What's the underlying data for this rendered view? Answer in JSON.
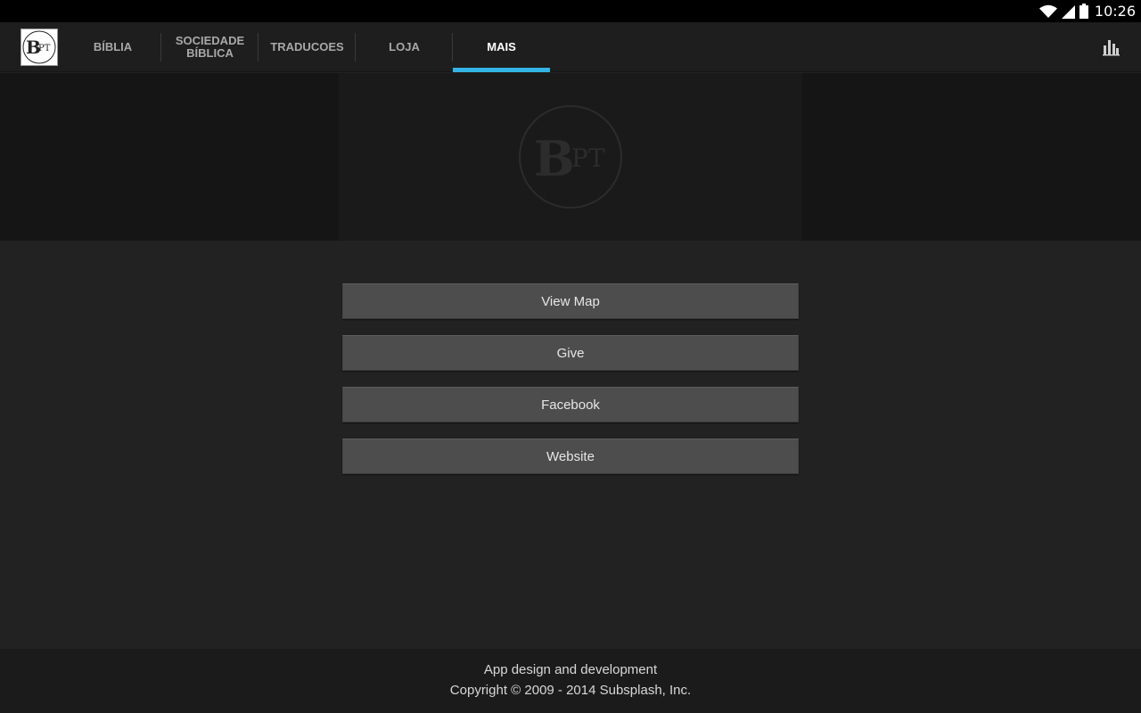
{
  "status_bar": {
    "time": "10:26",
    "icons": [
      "wifi-icon",
      "signal-icon",
      "battery-icon"
    ]
  },
  "app_bar": {
    "logo": {
      "letter_big": "B",
      "letter_small": "PT"
    },
    "tabs": [
      {
        "label": "BÍBLIA",
        "active": false
      },
      {
        "label_line1": "SOCIEDADE",
        "label_line2": "BÍBLICA",
        "active": false
      },
      {
        "label": "TRADUCOES",
        "active": false
      },
      {
        "label": "LOJA",
        "active": false
      },
      {
        "label": "MAIS",
        "active": true
      }
    ],
    "action_icon": "bar-chart-icon"
  },
  "header": {
    "logo": {
      "letter_big": "B",
      "letter_small": "PT"
    }
  },
  "actions": [
    {
      "label": "View Map"
    },
    {
      "label": "Give"
    },
    {
      "label": "Facebook"
    },
    {
      "label": "Website"
    }
  ],
  "footer": {
    "line1": "App design and development",
    "line2": "Copyright © 2009 - 2014 Subsplash, Inc."
  },
  "colors": {
    "accent": "#33b5e5",
    "background": "#222222",
    "button": "#4d4d4d"
  }
}
